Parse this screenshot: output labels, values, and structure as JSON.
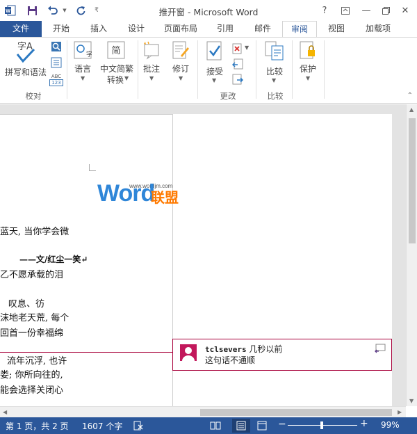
{
  "window": {
    "title": "推开窗 - Microsoft Word",
    "help": "?",
    "minimize": "—",
    "close": "✕"
  },
  "tabs": [
    {
      "label": "文件"
    },
    {
      "label": "开始"
    },
    {
      "label": "插入"
    },
    {
      "label": "设计"
    },
    {
      "label": "页面布局"
    },
    {
      "label": "引用"
    },
    {
      "label": "邮件"
    },
    {
      "label": "审阅"
    },
    {
      "label": "视图"
    },
    {
      "label": "加载项"
    }
  ],
  "ribbon": {
    "spelling": "拼写和语法",
    "abc_small": "ABC",
    "abc_num": "123",
    "language": "语言",
    "chinese_convert_1": "中文简繁",
    "chinese_convert_2": "转换",
    "comments": "批注",
    "tracking": "修订",
    "accept": "接受",
    "compare": "比较",
    "protect": "保护",
    "group_proofing": "校对",
    "group_changes": "更改",
    "group_compare": "比较"
  },
  "document": {
    "watermark_url": "www.wordjm.com",
    "watermark_word": "Word",
    "watermark_cn": "联盟",
    "lines": [
      "蓝天, 当你学会微",
      "——文/红尘一笑↵",
      "乙不愿承载的泪",
      "叹息、彷",
      "沫地老天荒, 每个",
      "回首一份幸福绵",
      "流年沉浮, 也许",
      "娄; 你所向往的,",
      "能会选择关闭心"
    ]
  },
  "comment": {
    "author": "tclsevers",
    "time": " 几秒以前",
    "text": "这句话不通顺"
  },
  "statusbar": {
    "page": "第 1 页，共 2 页",
    "words": "1607 个字",
    "zoom": "99%"
  },
  "colors": {
    "accent": "#2b579a",
    "comment_border": "#a8003a",
    "watermark_blue": "#2f86d8",
    "watermark_orange": "#ff7a00"
  }
}
